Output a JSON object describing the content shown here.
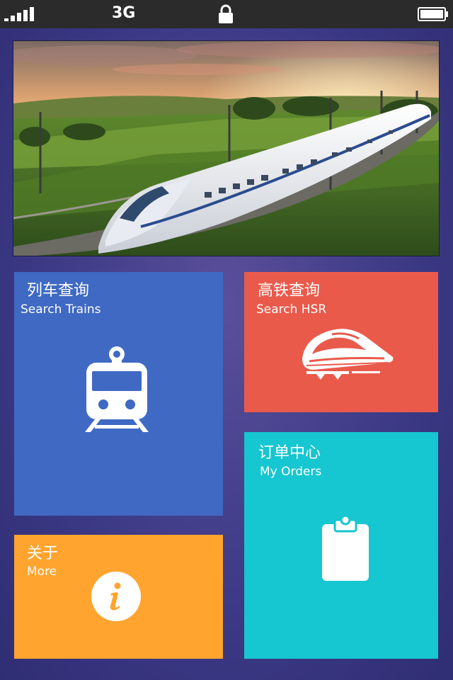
{
  "status_bar": {
    "network": "3G"
  },
  "banner": {
    "image": "high-speed-train-photo"
  },
  "tiles": {
    "search_trains": {
      "cn": "列车查询",
      "en": "Search Trains",
      "color": "#3f69c3",
      "icon": "train-icon"
    },
    "search_hsr": {
      "cn": "高铁查询",
      "en": "Search HSR",
      "color": "#ea5a4b",
      "icon": "bullet-train-icon"
    },
    "my_orders": {
      "cn": "订单中心",
      "en": "My Orders",
      "color": "#16c6d0",
      "icon": "clipboard-icon"
    },
    "more": {
      "cn": "关于",
      "en": "More",
      "color": "#ffa42e",
      "icon": "info-icon"
    }
  }
}
